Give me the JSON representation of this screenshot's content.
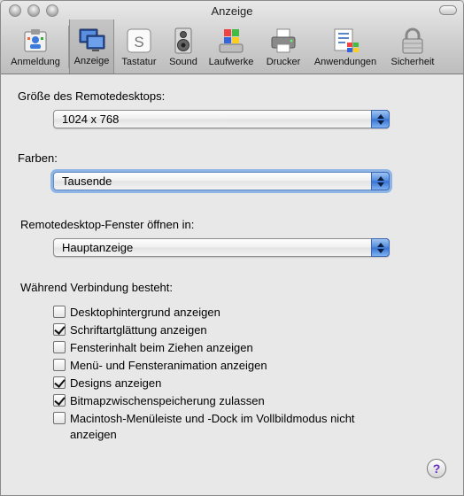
{
  "window": {
    "title": "Anzeige"
  },
  "toolbar": {
    "items": [
      {
        "label": "Anmeldung",
        "icon": "login-card-icon"
      },
      {
        "label": "Anzeige",
        "icon": "display-icon"
      },
      {
        "label": "Tastatur",
        "icon": "keyboard-key-icon"
      },
      {
        "label": "Sound",
        "icon": "speaker-icon"
      },
      {
        "label": "Laufwerke",
        "icon": "drive-windows-icon"
      },
      {
        "label": "Drucker",
        "icon": "printer-icon"
      },
      {
        "label": "Anwendungen",
        "icon": "applications-icon"
      },
      {
        "label": "Sicherheit",
        "icon": "padlock-icon"
      }
    ],
    "selected": "Anzeige"
  },
  "resolution": {
    "label": "Größe des Remotedesktops:",
    "value": "1024 x 768"
  },
  "colors": {
    "label": "Farben:",
    "value": "Tausende"
  },
  "window_open": {
    "label": "Remotedesktop-Fenster öffnen in:",
    "value": "Hauptanzeige"
  },
  "connection": {
    "label": "Während Verbindung besteht:",
    "options": [
      {
        "text": "Desktophintergrund anzeigen",
        "checked": false
      },
      {
        "text": "Schriftartglättung anzeigen",
        "checked": true
      },
      {
        "text": "Fensterinhalt beim Ziehen anzeigen",
        "checked": false
      },
      {
        "text": "Menü- und Fensteranimation anzeigen",
        "checked": false
      },
      {
        "text": "Designs anzeigen",
        "checked": true
      },
      {
        "text": "Bitmapzwischenspeicherung zulassen",
        "checked": true
      },
      {
        "text": "Macintosh-Menüleiste und -Dock im Vollbildmodus nicht",
        "text2": "anzeigen",
        "checked": false
      }
    ]
  },
  "help": {
    "label": "?"
  },
  "colors_theme": {
    "accent": "#3471d4",
    "focus_ring": "#8eb5e6",
    "background": "#e8e8e8"
  }
}
